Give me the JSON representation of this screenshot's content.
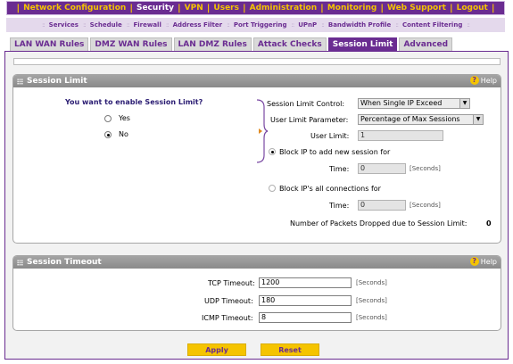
{
  "top_nav": {
    "items": [
      "Network Configuration",
      "Security",
      "VPN",
      "Users",
      "Administration",
      "Monitoring",
      "Web Support",
      "Logout"
    ],
    "active": "Security"
  },
  "sub_nav": {
    "items": [
      "Services",
      "Schedule",
      "Firewall",
      "Address Filter",
      "Port Triggering",
      "UPnP",
      "Bandwidth Profile",
      "Content Filtering"
    ]
  },
  "tabs": [
    "LAN WAN Rules",
    "DMZ WAN Rules",
    "LAN DMZ Rules",
    "Attack Checks",
    "Session Limit",
    "Advanced"
  ],
  "active_tab": "Session Limit",
  "session_limit": {
    "title": "Session Limit",
    "help": "Help",
    "enable_question": "You want to enable Session Limit?",
    "yes_label": "Yes",
    "no_label": "No",
    "enable_selected": "No",
    "control_label": "Session Limit Control:",
    "control_value": "When Single IP Exceed",
    "user_param_label": "User Limit Parameter:",
    "user_param_value": "Percentage of Max Sessions",
    "user_limit_label": "User Limit:",
    "user_limit_value": "1",
    "block_new_label": "Block IP to add new session for",
    "block_new_time_label": "Time:",
    "block_new_time_value": "0",
    "block_all_label": "Block IP's all connections for",
    "block_all_time_label": "Time:",
    "block_all_time_value": "0",
    "seconds_unit": "[Seconds]",
    "dropped_label": "Number of Packets Dropped due to Session Limit:",
    "dropped_value": "0",
    "block_selected": "Block IP to add new session for"
  },
  "session_timeout": {
    "title": "Session Timeout",
    "help": "Help",
    "tcp_label": "TCP Timeout:",
    "tcp_value": "1200",
    "udp_label": "UDP Timeout:",
    "udp_value": "180",
    "icmp_label": "ICMP Timeout:",
    "icmp_value": "8",
    "seconds_unit": "[Seconds]"
  },
  "buttons": {
    "apply": "Apply",
    "reset": "Reset"
  },
  "colors": {
    "brand_purple": "#6a2c91",
    "accent_yellow": "#f5c400",
    "panel_header": "#999999"
  }
}
